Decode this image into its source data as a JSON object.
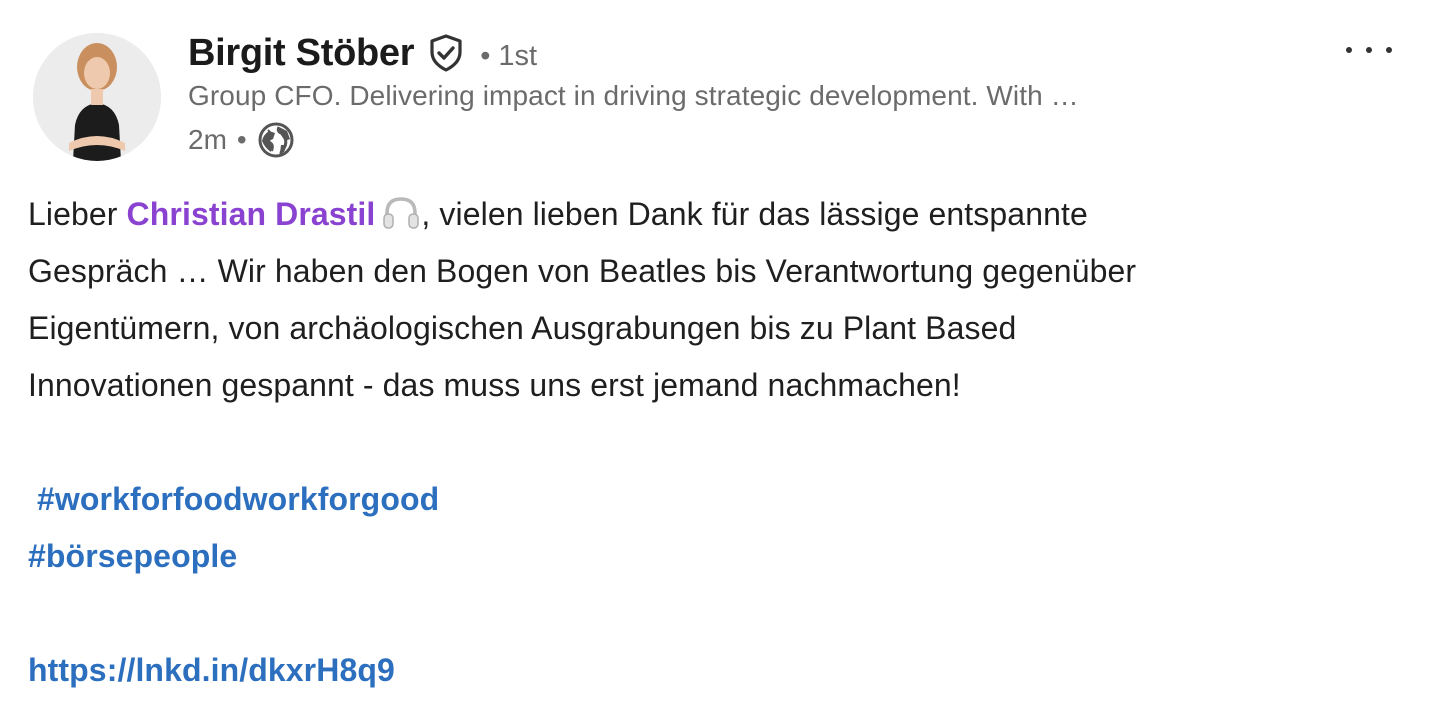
{
  "author": {
    "name": "Birgit Stöber",
    "degree": "• 1st",
    "headline": "Group CFO. Delivering impact in driving strategic development. With …",
    "time": "2m",
    "meta_separator": "•"
  },
  "post": {
    "line1_pre": "Lieber ",
    "mention": "Christian Drastil",
    "line1_post": ", vielen lieben Dank für das lässige entspannte",
    "line2": "Gespräch … Wir haben den Bogen von Beatles bis Verantwortung gegenüber",
    "line3": "Eigentümern, von archäologischen Ausgrabungen bis zu Plant Based",
    "line4": "Innovationen gespannt - das muss uns erst jemand nachmachen!",
    "hashtags": [
      "#workforfoodworkforgood",
      "#börsepeople"
    ],
    "link": "https://lnkd.in/dkxrH8q9"
  },
  "icons": {
    "verified": "verified-shield-icon",
    "globe": "globe-icon",
    "more": "more-options-icon",
    "headphones": "headphones-emoji-icon"
  },
  "colors": {
    "mention": "#8a43d0",
    "hashtag": "#2c6fbf",
    "meta": "#6b6b6b"
  }
}
